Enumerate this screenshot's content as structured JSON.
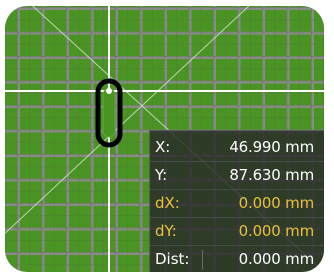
{
  "readout": {
    "x": {
      "label": "X:",
      "value": "46.990 mm"
    },
    "y": {
      "label": "Y:",
      "value": "87.630 mm"
    },
    "dx": {
      "label": "dX:",
      "value": "0.000 mm"
    },
    "dy": {
      "label": "dY:",
      "value": "0.000 mm"
    },
    "dist": {
      "label": "Dist:",
      "value": "0.000 mm"
    }
  },
  "colors": {
    "board": "#4a9424",
    "grid": "#8a8a8a",
    "crosshair": "#ffffff",
    "readout_bg": "#282828",
    "delta_text": "#e8c23a"
  },
  "icons": {
    "cursor": "crosshair-cursor-icon",
    "pad": "oblong-pad-icon"
  }
}
